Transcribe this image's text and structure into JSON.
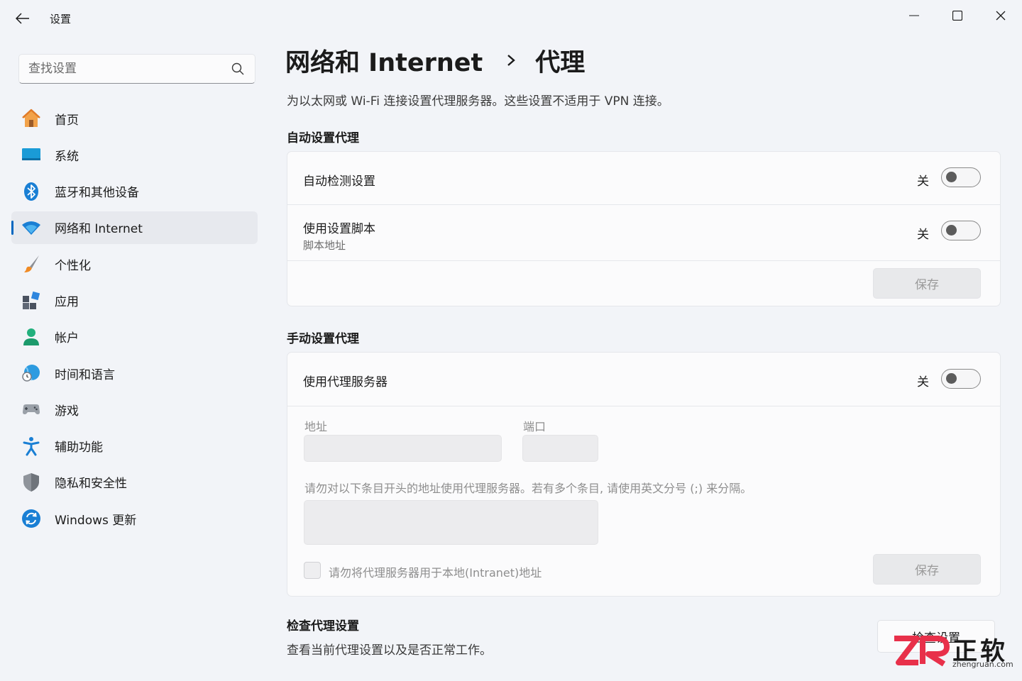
{
  "window": {
    "title": "设置",
    "controls": [
      "minimize",
      "maximize",
      "close"
    ]
  },
  "search": {
    "placeholder": "查找设置",
    "value": ""
  },
  "sidebar": {
    "items": [
      {
        "label": "首页",
        "icon": "home-icon",
        "active": false
      },
      {
        "label": "系统",
        "icon": "system-icon",
        "active": false
      },
      {
        "label": "蓝牙和其他设备",
        "icon": "bluetooth-icon",
        "active": false
      },
      {
        "label": "网络和 Internet",
        "icon": "network-icon",
        "active": true
      },
      {
        "label": "个性化",
        "icon": "brush-icon",
        "active": false
      },
      {
        "label": "应用",
        "icon": "apps-icon",
        "active": false
      },
      {
        "label": "帐户",
        "icon": "account-icon",
        "active": false
      },
      {
        "label": "时间和语言",
        "icon": "globe-clock-icon",
        "active": false
      },
      {
        "label": "游戏",
        "icon": "gamepad-icon",
        "active": false
      },
      {
        "label": "辅助功能",
        "icon": "accessibility-icon",
        "active": false
      },
      {
        "label": "隐私和安全性",
        "icon": "shield-icon",
        "active": false
      },
      {
        "label": "Windows 更新",
        "icon": "update-icon",
        "active": false
      }
    ]
  },
  "header": {
    "parent": "网络和 Internet",
    "separator_icon": "chevron-right-icon",
    "current": "代理"
  },
  "description": "为以太网或 Wi-Fi 连接设置代理服务器。这些设置不适用于 VPN 连接。",
  "auto_proxy": {
    "title": "自动设置代理",
    "detect": {
      "label": "自动检测设置",
      "state": "关",
      "on": false
    },
    "script": {
      "label": "使用设置脚本",
      "sublabel": "脚本地址",
      "state": "关",
      "on": false
    },
    "save_label": "保存"
  },
  "manual_proxy": {
    "title": "手动设置代理",
    "use_proxy": {
      "label": "使用代理服务器",
      "state": "关",
      "on": false
    },
    "address_label": "地址",
    "address_value": "",
    "port_label": "端口",
    "port_value": "",
    "exceptions_note": "请勿对以下条目开头的地址使用代理服务器。若有多个条目, 请使用英文分号 (;) 来分隔。",
    "exceptions_value": "",
    "local_checkbox_label": "请勿将代理服务器用于本地(Intranet)地址",
    "local_checkbox_checked": false,
    "save_label": "保存"
  },
  "check_proxy": {
    "title": "检查代理设置",
    "description": "查看当前代理设置以及是否正常工作。",
    "button_label": "检查设置"
  },
  "watermark": {
    "logo": "ZR",
    "text": "正软",
    "url": "zhengruan.com"
  },
  "colors": {
    "accent": "#0067c0",
    "background": "#f2f4f8",
    "card": "#fbfbfc",
    "watermark_red": "#e8304a"
  }
}
